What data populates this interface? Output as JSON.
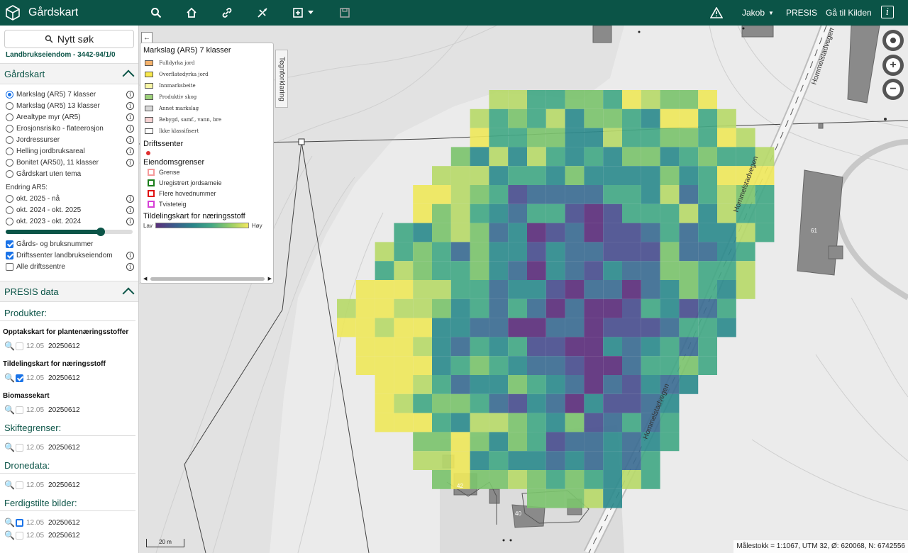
{
  "app": {
    "title": "Gårdskart"
  },
  "topbar": {
    "user": "Jakob",
    "precis": "PRESIS",
    "kilden": "Gå til Kilden"
  },
  "sidebar": {
    "search": "Nytt søk",
    "property": "Landbrukseiendom - 3442-94/1/0",
    "section1": "Gårdskart",
    "themes": [
      "Markslag (AR5) 7 klasser",
      "Markslag (AR5) 13 klasser",
      "Arealtype myr (AR5)",
      "Erosjonsrisiko - flateerosjon",
      "Jordressurser",
      "Helling jordbruksareal",
      "Bonitet (AR50), 11 klasser",
      "Gårdskart uten tema"
    ],
    "change_label": "Endring AR5:",
    "changes": [
      "okt. 2025 - nå",
      "okt. 2024 - okt. 2025",
      "okt. 2023 - okt. 2024"
    ],
    "checks": [
      "Gårds- og bruksnummer",
      "Driftssenter landbrukseiendom",
      "Alle driftssentre"
    ],
    "section2": "PRESIS data",
    "products_label": "Produkter:",
    "p1_title": "Opptakskart for plantenæringsstoffer",
    "p2_title": "Tildelingskart for næringsstoff",
    "p3_title": "Biomassekart",
    "skifte_label": "Skiftegrenser:",
    "drone_label": "Dronedata:",
    "bilder_label": "Ferdigstilte bilder:",
    "date": "12.05",
    "value": "20250612"
  },
  "legend": {
    "title": "Markslag (AR5) 7 klasser",
    "classes": [
      {
        "label": "Fulldyrka jord",
        "color": "#f5b26b"
      },
      {
        "label": "Overflatedyrka jord",
        "color": "#f8e84c"
      },
      {
        "label": "Innmarksbeite",
        "color": "#f8f7a6"
      },
      {
        "label": "Produktiv skog",
        "color": "#9dd17a"
      },
      {
        "label": "Annet markslag",
        "color": "#d8d8d8"
      },
      {
        "label": "Bebygd, samf., vann, bre",
        "color": "#f7d3d3"
      },
      {
        "label": "Ikke klassifisert",
        "color": "#ffffff"
      }
    ],
    "drift_head": "Driftssenter",
    "eiend_head": "Eiendomsgrenser",
    "bounds": [
      {
        "label": "Grense",
        "color": "#f59a9a"
      },
      {
        "label": "Uregistrert jordsameie",
        "color": "#1a7d1a"
      },
      {
        "label": "Flere hovednummer",
        "color": "#e01010"
      },
      {
        "label": "Tvisteteig",
        "color": "#d640d6"
      }
    ],
    "grad_head": "Tildelingskart for næringsstoff",
    "low": "Lav",
    "high": "Høy",
    "tab": "Tegnforklaring"
  },
  "map": {
    "road_label": "Hommelstadvegen",
    "buildings": [
      "61",
      "42",
      "40"
    ],
    "scalebar": "20 m",
    "status": "Målestokk = 1:1067, UTM 32, Ø: 620068, N: 6742556"
  }
}
